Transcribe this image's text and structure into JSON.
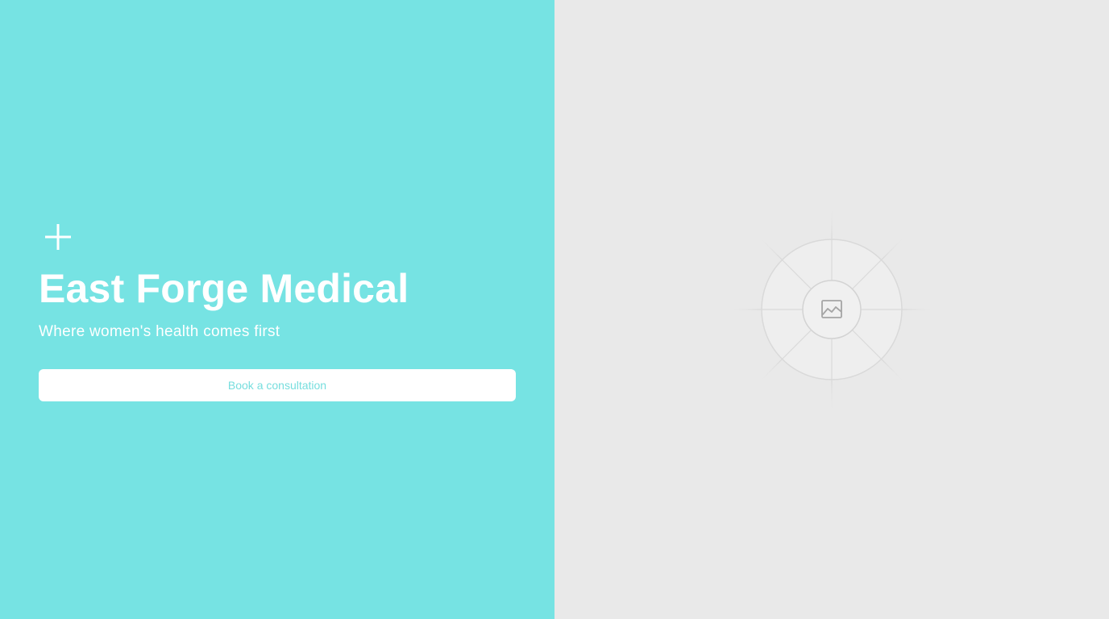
{
  "hero": {
    "brand_icon": "plus-icon",
    "title": "East Forge Medical",
    "tagline": "Where women's health comes first",
    "cta_label": "Book a consultation"
  },
  "media": {
    "placeholder_icon": "image-icon"
  },
  "colors": {
    "accent": "#76e3e3",
    "panel_gray": "#e9e9e9",
    "text_on_accent": "#ffffff"
  }
}
